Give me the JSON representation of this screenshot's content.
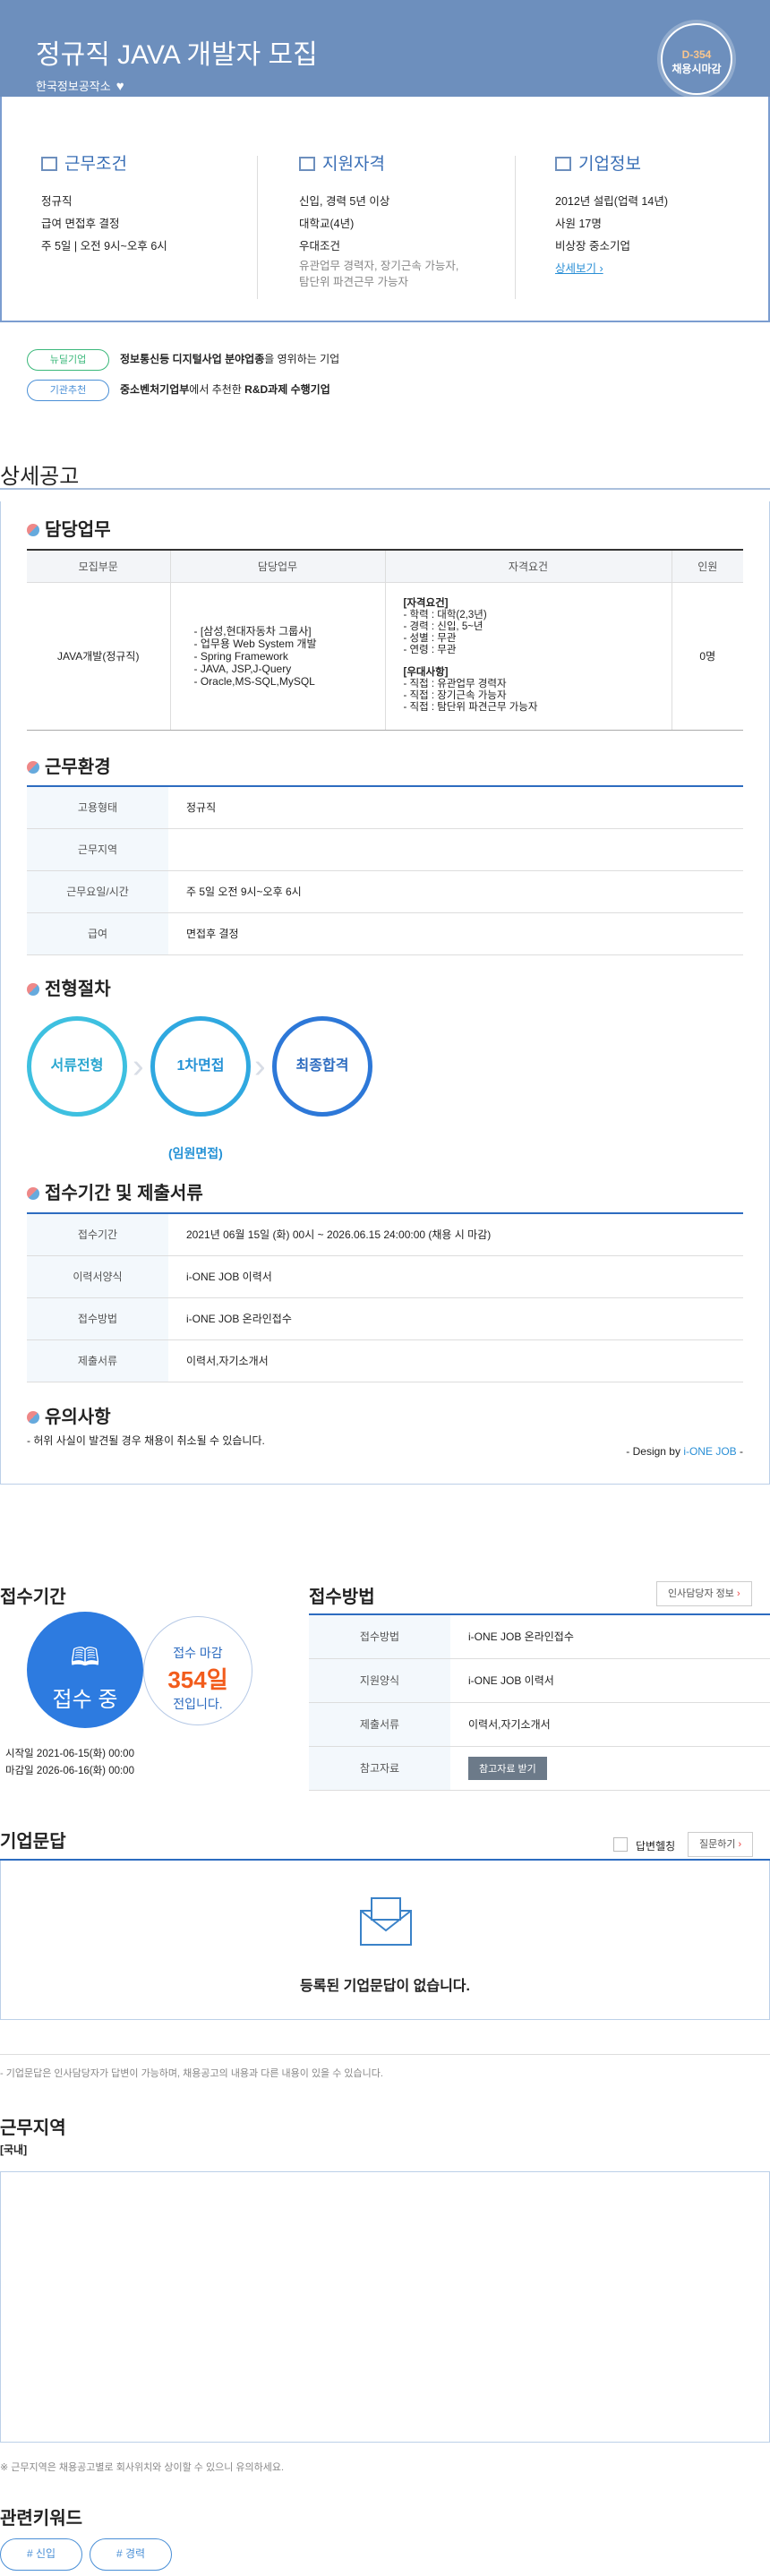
{
  "header": {
    "title": "정규직 JAVA 개발자 모집",
    "company": "한국정보공작소",
    "dday_num": "D-354",
    "dday_label": "채용시마감"
  },
  "summary": {
    "work": {
      "title": "근무조건",
      "lines": [
        "정규직",
        "급여 면접후 결정",
        "주 5일 | 오전 9시~오후 6시"
      ]
    },
    "qual": {
      "title": "지원자격",
      "lines": [
        "신입, 경력 5년 이상",
        "대학교(4년)",
        "우대조건"
      ],
      "gray": [
        "유관업무 경력자, 장기근속 가능자,",
        "탐단위 파견근무 가능자"
      ]
    },
    "company": {
      "title": "기업정보",
      "lines": [
        "2012년 설립(업력 14년)",
        "사원 17명",
        "비상장 중소기업"
      ],
      "more": "상세보기 ›"
    }
  },
  "badges": [
    {
      "label": "뉴딜기업",
      "pre": "정보통신등 디지털사업 분야업종",
      "post": "을 영위하는 기업"
    },
    {
      "label": "기관추천",
      "pre": "중소벤처기업부",
      "mid": "에서 추천한 ",
      "bold": "R&D과제 수행기업"
    }
  ],
  "detail": {
    "title": "상세공고",
    "duty": {
      "title": "담당업무",
      "headers": [
        "모집부문",
        "담당업무",
        "자격요건",
        "인원"
      ],
      "row": {
        "dept": "JAVA개발(정규직)",
        "tasks": [
          "- [삼성,현대자동차 그룹사]",
          "- 업무용 Web System 개발",
          "- Spring Framework",
          "- JAVA, JSP,J-Query",
          "- Oracle,MS-SQL,MySQL"
        ],
        "req_title": "[자격요건]",
        "req": [
          "- 학력 : 대학(2,3년)",
          "- 경력 : 신입, 5~년",
          "- 성별 : 무관",
          "- 연령 : 무관"
        ],
        "pref_title": "[우대사항]",
        "pref": [
          "- 직접 : 유관업무 경력자",
          "- 직접 : 장기근속 가능자",
          "- 직접 : 탐단위 파견근무 가능자"
        ],
        "count": "0명"
      }
    },
    "env": {
      "title": "근무환경",
      "rows": [
        [
          "고용형태",
          "정규직"
        ],
        [
          "근무지역",
          ""
        ],
        [
          "근무요일/시간",
          "주 5일 오전 9시~오후 6시"
        ],
        [
          "급여",
          "면접후 결정"
        ]
      ]
    },
    "process": {
      "title": "전형절차",
      "steps": [
        "서류전형",
        "1차면접",
        "최종합격"
      ],
      "note": "(임원면접)"
    },
    "period": {
      "title": "접수기간 및 제출서류",
      "rows": [
        [
          "접수기간",
          "2021년 06월 15일 (화) 00시 ~ 2026.06.15 24:00:00 (채용 시 마감)"
        ],
        [
          "이력서양식",
          "i-ONE JOB 이력서"
        ],
        [
          "접수방법",
          "i-ONE JOB 온라인접수"
        ],
        [
          "제출서류",
          "이력서,자기소개서"
        ]
      ]
    },
    "notice": {
      "title": "유의사항",
      "text": "- 허위 사실이 발견될 경우 채용이 취소될 수 있습니다.",
      "design_pre": "- Design by ",
      "design_brand": "i-ONE JOB",
      "design_post": " -"
    }
  },
  "apply": {
    "title": "접수기간",
    "status": "접수 중",
    "deadline_label": "접수 마감",
    "days": "354일",
    "days_suffix": "전입니다.",
    "start": "시작일 2021-06-15(화) 00:00",
    "end": "마감일 2026-06-16(화) 00:00"
  },
  "method": {
    "title": "접수방법",
    "hr_btn": "인사담당자 정보",
    "rows": [
      [
        "접수방법",
        "i-ONE JOB 온라인접수"
      ],
      [
        "지원양식",
        "i-ONE JOB 이력서"
      ],
      [
        "제출서류",
        "이력서,자기소개서"
      ],
      [
        "참고자료",
        ""
      ]
    ],
    "ref_btn": "참고자료 받기"
  },
  "qa": {
    "title": "기업문답",
    "answered": "답변헬칭",
    "ask_btn": "질문하기",
    "empty": "등록된 기업문답이 없습니다.",
    "note": "- 기업문답은 인사담당자가 답변이 가능하며, 채용공고의 내용과 다른 내용이 있을 수 있습니다."
  },
  "location": {
    "title": "근무지역",
    "sub": "[국내]",
    "note": "※ 근무지역은 채용공고별로 회사위치와 상이할 수 있으니 유의하세요."
  },
  "keywords": {
    "title": "관련키워드",
    "items": [
      "# 신입",
      "# 경력"
    ]
  },
  "colors": {
    "header": "#6d8fbd",
    "accent": "#2d6cc0",
    "orange": "#f25c1c"
  }
}
